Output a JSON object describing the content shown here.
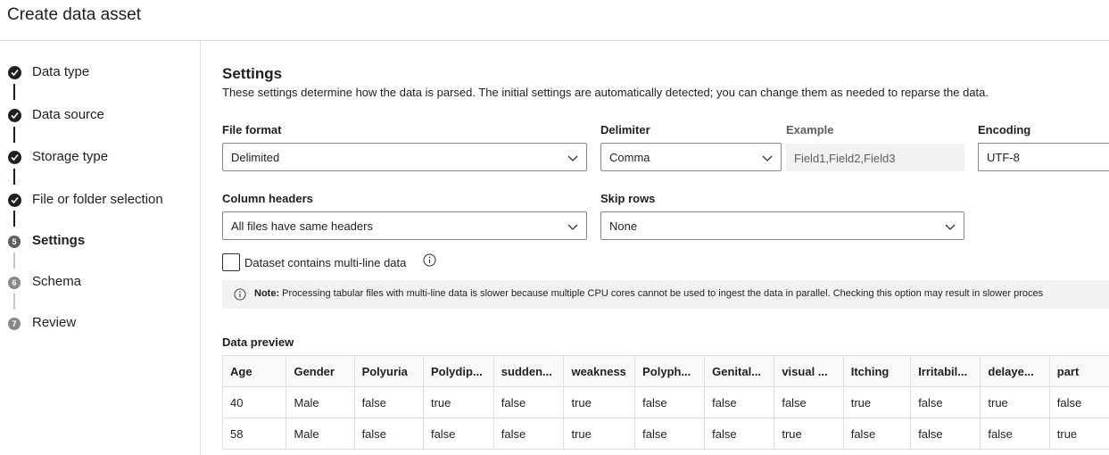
{
  "header": {
    "title": "Create data asset"
  },
  "steps": [
    {
      "label": "Data type",
      "state": "done"
    },
    {
      "label": "Data source",
      "state": "done"
    },
    {
      "label": "Storage type",
      "state": "done"
    },
    {
      "label": "File or folder selection",
      "state": "done"
    },
    {
      "label": "Settings",
      "state": "current",
      "number": "5"
    },
    {
      "label": "Schema",
      "state": "pending",
      "number": "6"
    },
    {
      "label": "Review",
      "state": "pending",
      "number": "7"
    }
  ],
  "settings": {
    "title": "Settings",
    "description": "These settings determine how the data is parsed. The initial settings are automatically detected; you can change them as needed to reparse the data.",
    "file_format": {
      "label": "File format",
      "value": "Delimited"
    },
    "delimiter": {
      "label": "Delimiter",
      "value": "Comma"
    },
    "example": {
      "label": "Example",
      "value": "Field1,Field2,Field3"
    },
    "encoding": {
      "label": "Encoding",
      "value": "UTF-8"
    },
    "column_headers": {
      "label": "Column headers",
      "value": "All files have same headers"
    },
    "skip_rows": {
      "label": "Skip rows",
      "value": "None"
    },
    "multiline": {
      "label": "Dataset contains multi-line data",
      "checked": false
    },
    "note": {
      "prefix": "Note:",
      "text": "Processing tabular files with multi-line data is slower because multiple CPU cores cannot be used to ingest the data in parallel. Checking this option may result in slower proces"
    }
  },
  "preview": {
    "label": "Data preview",
    "columns": [
      "Age",
      "Gender",
      "Polyuria",
      "Polydip...",
      "sudden...",
      "weakness",
      "Polyph...",
      "Genital...",
      "visual ...",
      "Itching",
      "Irritabil...",
      "delaye...",
      "part"
    ],
    "rows": [
      [
        "40",
        "Male",
        "false",
        "true",
        "false",
        "true",
        "false",
        "false",
        "false",
        "true",
        "false",
        "true",
        "false"
      ],
      [
        "58",
        "Male",
        "false",
        "false",
        "false",
        "true",
        "false",
        "false",
        "true",
        "false",
        "false",
        "false",
        "true"
      ]
    ]
  }
}
